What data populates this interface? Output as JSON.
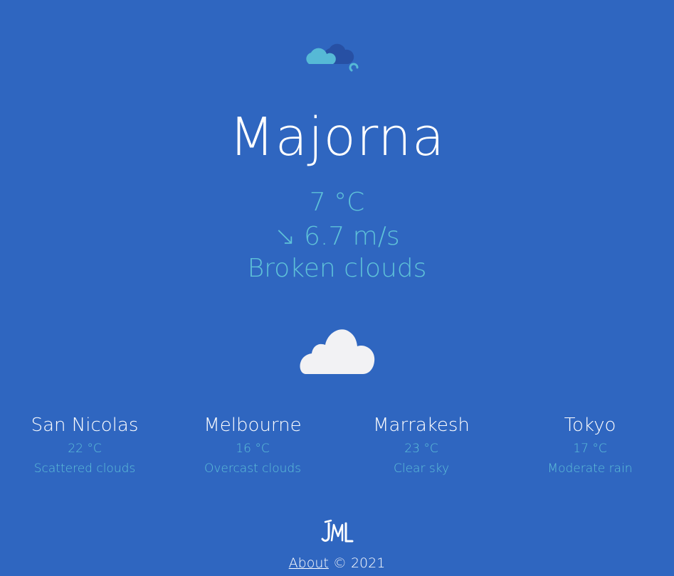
{
  "header": {
    "logo_icon": "cloud-logo-icon"
  },
  "current": {
    "city": "Majorna",
    "temperature": "7 °C",
    "wind": "↘ 6.7 m/s",
    "description": "Broken clouds",
    "icon": "cloud-icon"
  },
  "cities": [
    {
      "name": "San Nicolas",
      "temperature": "22 °C",
      "description": "Scattered clouds"
    },
    {
      "name": "Melbourne",
      "temperature": "16 °C",
      "description": "Overcast clouds"
    },
    {
      "name": "Marrakesh",
      "temperature": "23 °C",
      "description": "Clear sky"
    },
    {
      "name": "Tokyo",
      "temperature": "17 °C",
      "description": "Moderate rain"
    }
  ],
  "footer": {
    "logo_text": "JML",
    "about_label": "About",
    "copyright": "© 2021"
  },
  "colors": {
    "background": "#2f66c0",
    "accent": "#5ec1d8",
    "text": "#ffffff"
  }
}
